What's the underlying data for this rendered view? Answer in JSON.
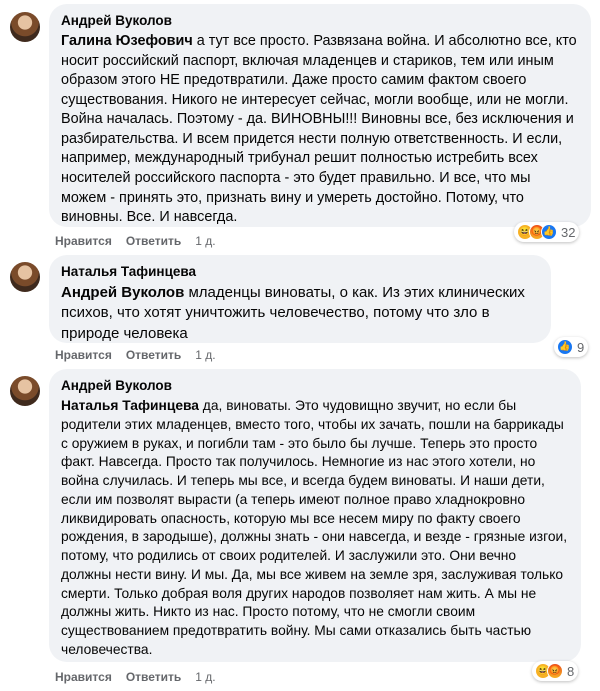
{
  "comments": [
    {
      "author": "Андрей Вуколов",
      "mention": "Галина Юзефович",
      "text": " а тут все просто. Развязана война. И абсолютно все, кто носит российский паспорт, включая младенцев и стариков, тем или иным образом этого НЕ предотвратили. Даже просто самим фактом своего существования. Никого не интересует сейчас, могли вообще, или не могли. Война началась. Поэтому - да. ВИНОВНЫ!!! Виновны все, без исключения и разбирательства. И всем придется нести полную ответственность. И если, например, международный трибунал решит полностью истребить всех носителей российского паспорта - это будет правильно. И все, что мы можем - принять это, признать вину и умереть достойно. Потому, что виновны. Все. И навсегда.",
      "like_label": "Нравится",
      "reply_label": "Ответить",
      "time": "1 д.",
      "reactions": [
        "haha-icon",
        "angry-icon",
        "like-icon"
      ],
      "reaction_count": "32"
    },
    {
      "author": "Наталья Тафинцева",
      "mention": "Андрей Вуколов",
      "text": " младенцы виноваты, о как. Из этих клинических психов, что хотят уничтожить человечество, потому что зло в природе человека",
      "like_label": "Нравится",
      "reply_label": "Ответить",
      "time": "1 д.",
      "reactions": [
        "like-icon"
      ],
      "reaction_count": "9"
    },
    {
      "author": "Андрей Вуколов",
      "mention": "Наталья Тафинцева",
      "text": " да, виноваты. Это чудовищно звучит, но если бы родители этих младенцев, вместо того, чтобы их зачать, пошли на баррикады с оружием в руках, и погибли там - это было бы лучше. Теперь это просто факт. Навсегда. Просто так получилось. Немногие из нас этого хотели, но война случилась. И теперь мы все, и всегда будем виноваты. И наши дети, если им позволят вырасти (а теперь имеют полное право хладнокровно ликвидировать опасность, которую мы все несем миру по факту своего рождения, в зародыше), должны знать - они навсегда, и везде - грязные изгои, потому, что родились от своих родителей. И заслужили это. Они вечно должны нести вину. И мы. Да, мы все живем на земле зря, заслуживая только смерти. Только добрая воля других народов позволяет нам жить. А мы не должны жить. Никто из нас. Просто потому, что не смогли своим существованием предотвратить войну. Мы сами отказались быть частью человечества.",
      "like_label": "Нравится",
      "reply_label": "Ответить",
      "time": "1 д.",
      "reactions": [
        "haha-icon",
        "angry-icon"
      ],
      "reaction_count": "8"
    }
  ],
  "colors": {
    "bubble": "#f0f2f5",
    "meta": "#65676b",
    "like": "#1877f2"
  }
}
